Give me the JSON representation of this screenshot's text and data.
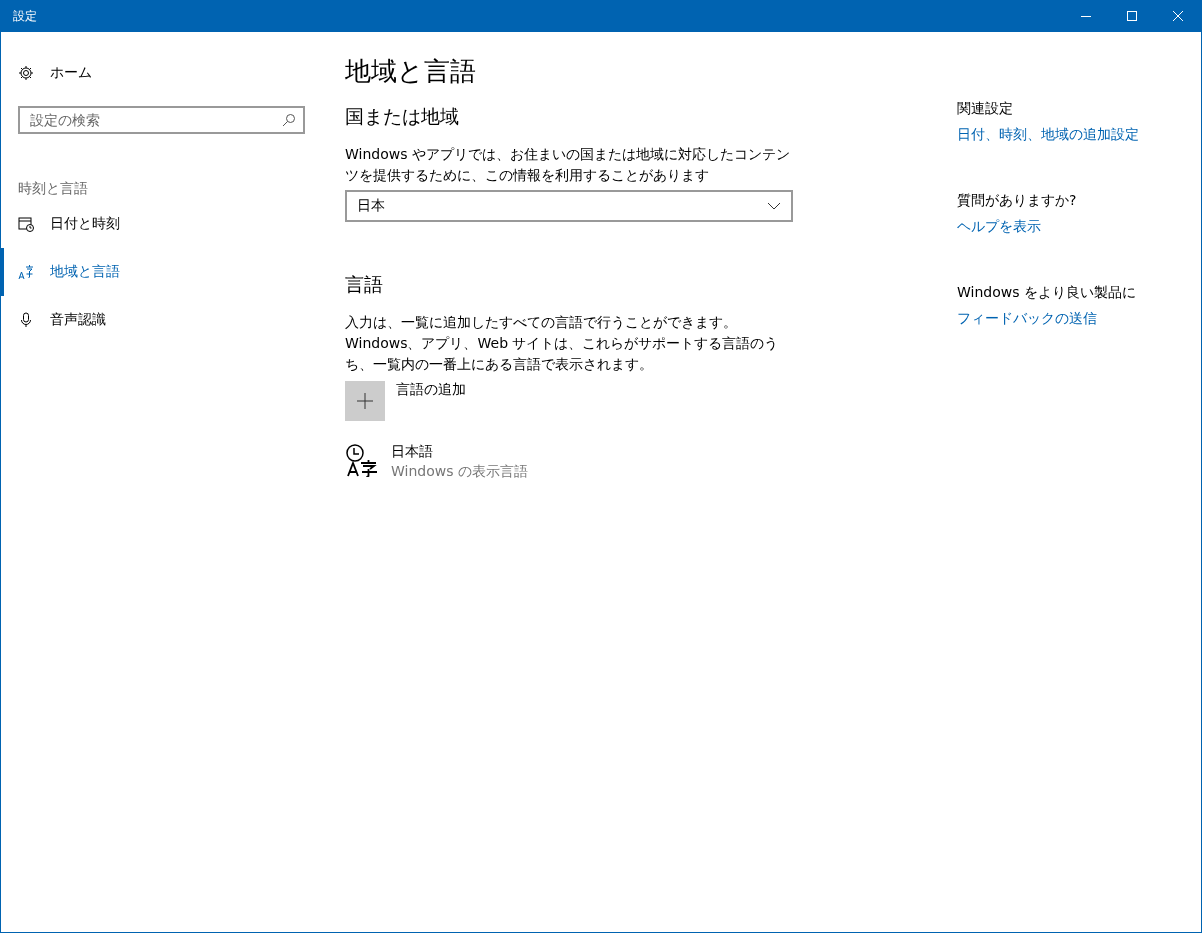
{
  "window": {
    "title": "設定"
  },
  "sidebar": {
    "home": "ホーム",
    "search": {
      "placeholder": "設定の検索"
    },
    "section": "時刻と言語",
    "items": [
      {
        "kind": "calendar",
        "label": "日付と時刻",
        "selected": false
      },
      {
        "kind": "language",
        "label": "地域と言語",
        "selected": true
      },
      {
        "kind": "microphone",
        "label": "音声認識",
        "selected": false
      }
    ]
  },
  "page": {
    "title": "地域と言語",
    "region": {
      "heading": "国または地域",
      "description": "Windows やアプリでは、お住まいの国または地域に対応したコンテンツを提供するために、この情報を利用することがあります",
      "value": "日本"
    },
    "languages": {
      "heading": "言語",
      "description": "入力は、一覧に追加したすべての言語で行うことができます。Windows、アプリ、Web サイトは、これらがサポートする言語のうち、一覧内の一番上にある言語で表示されます。",
      "add": "言語の追加",
      "items": [
        {
          "name": "日本語",
          "note": "Windows の表示言語"
        }
      ]
    }
  },
  "related": [
    {
      "heading": "関連設定",
      "link": "日付、時刻、地域の追加設定"
    },
    {
      "heading": "質問がありますか?",
      "link": "ヘルプを表示"
    },
    {
      "heading": "Windows をより良い製品に",
      "link": "フィードバックの送信"
    }
  ]
}
